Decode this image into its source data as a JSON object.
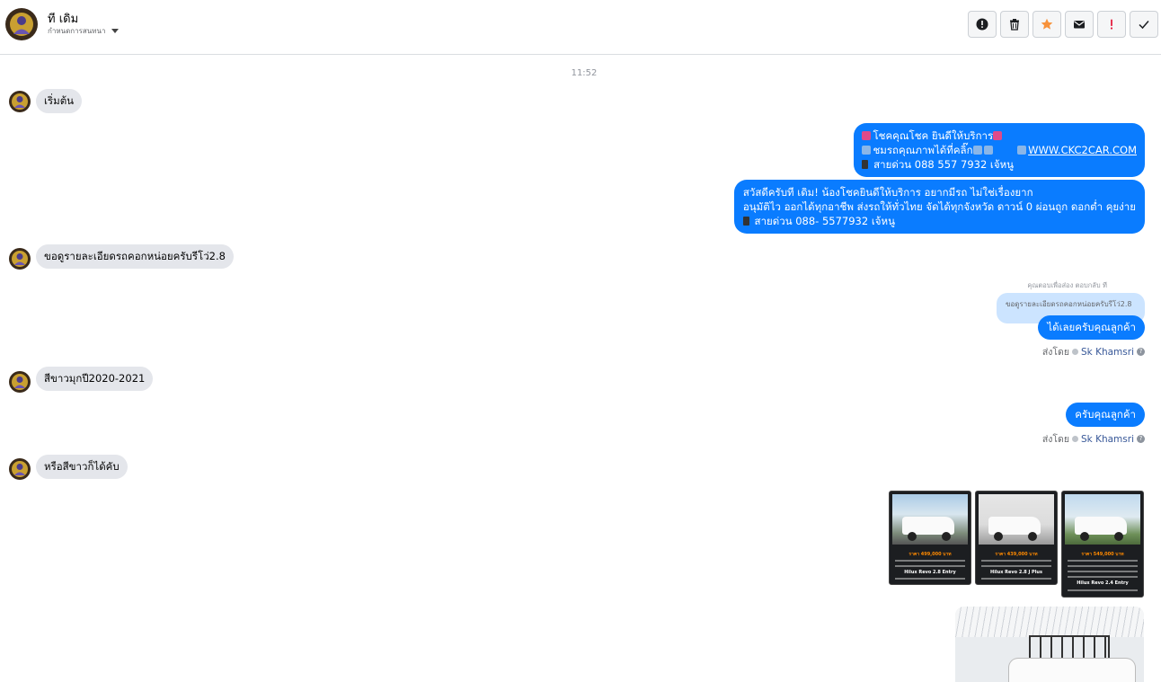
{
  "header": {
    "name": "ที เดิม",
    "subtitle": "กำหนดการสนทนา"
  },
  "toolbar": {
    "icons": [
      "info-icon",
      "trash-icon",
      "star-icon",
      "mail-icon",
      "alert-icon",
      "check-icon"
    ],
    "star_color": "#f7923b",
    "alert_color": "#e41e3f"
  },
  "messages": {
    "timestamp": "11:52",
    "in1": "เริ่มต้น",
    "out1_line1": "โชคคุณโชค ยินดีให้บริการ",
    "out1_line2": "ชมรถคุณภาพได้ที่คลิ๊ก",
    "out1_link": "WWW.CKC2CAR.COM",
    "out1_line3": "สายด่วน 088 557 7932 เจ้หนู",
    "out2_line1": "สวัสดีครับที เดิม! น้องโชคยินดีให้บริการ อยากมีรถ ไม่ใช่เรื่องยาก",
    "out2_line2": "อนุมัติไว ออกได้ทุกอาชีพ ส่งรถให้ทั่วไทย จัดได้ทุกจังหวัด ดาวน์ 0  ผ่อนถูก ดอกต่ำ คุยง่าย",
    "out2_line3": "สายด่วน 088- 5577932 เจ้หนู",
    "in2": "ขอดูรายละเอียดรถคอกหน่อยครับรีโว่2.8",
    "reply_context": "ตอบกลับ ที",
    "reply_sender_label": "คุณตอบเพื่อส่อง",
    "quoted": "ขอดูรายละเอียดรถคอกหน่อยครับรีโว่2.8",
    "out3": "ได้เลยครับคุณลูกค้า",
    "sent_by_label": "ส่งโดย",
    "sent_by_name": "Sk Khamsri",
    "in3": "สีขาวมุกปี2020-2021",
    "out4": "ครับคุณลูกค้า",
    "in4": "หรือสีขาวก็ได้คับ"
  },
  "images": [
    {
      "price": "ราคา 499,000 บาท",
      "model": "Hilux Revo 2.8 Entry"
    },
    {
      "price": "ราคา 439,000 บาท",
      "model": "Hilux Revo 2.8 J Plus"
    },
    {
      "price": "ราคา 549,000 บาท",
      "model": "Hilux Revo 2.4 Entry"
    }
  ],
  "colors": {
    "outgoing_bubble": "#0a7cff",
    "incoming_bubble": "#e4e6eb",
    "quoted_bubble": "#cce4ff",
    "link_name": "#385898"
  }
}
